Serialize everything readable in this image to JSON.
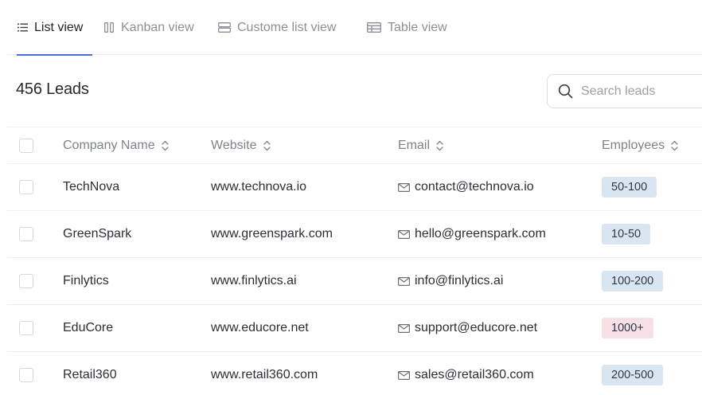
{
  "tabs": [
    {
      "label": "List view",
      "icon": "list-icon",
      "active": true
    },
    {
      "label": "Kanban view",
      "icon": "kanban-icon",
      "active": false
    },
    {
      "label": "Custome list view",
      "icon": "custom-list-icon",
      "active": false
    },
    {
      "label": "Table view",
      "icon": "table-icon",
      "active": false
    }
  ],
  "header": {
    "count_title": "456 Leads"
  },
  "search": {
    "placeholder": "Search leads",
    "value": ""
  },
  "columns": {
    "company": "Company Name",
    "website": "Website",
    "email": "Email",
    "employees": "Employees"
  },
  "rows": [
    {
      "company": "TechNova",
      "website": "www.technova.io",
      "email": "contact@technova.io",
      "employees": "50-100",
      "badge_color": "#d9e6f1"
    },
    {
      "company": "GreenSpark",
      "website": "www.greenspark.com",
      "email": "hello@greenspark.com",
      "employees": "10-50",
      "badge_color": "#d9e6f1"
    },
    {
      "company": "Finlytics",
      "website": "www.finlytics.ai",
      "email": "info@finlytics.ai",
      "employees": "100-200",
      "badge_color": "#d9e6f1"
    },
    {
      "company": "EduCore",
      "website": "www.educore.net",
      "email": "support@educore.net",
      "employees": "1000+",
      "badge_color": "#f7dfe6"
    },
    {
      "company": "Retail360",
      "website": "www.retail360.com",
      "email": "sales@retail360.com",
      "employees": "200-500",
      "badge_color": "#d9e6f1"
    }
  ],
  "colors": {
    "accent": "#4a6fd8",
    "border": "#eceef1"
  }
}
